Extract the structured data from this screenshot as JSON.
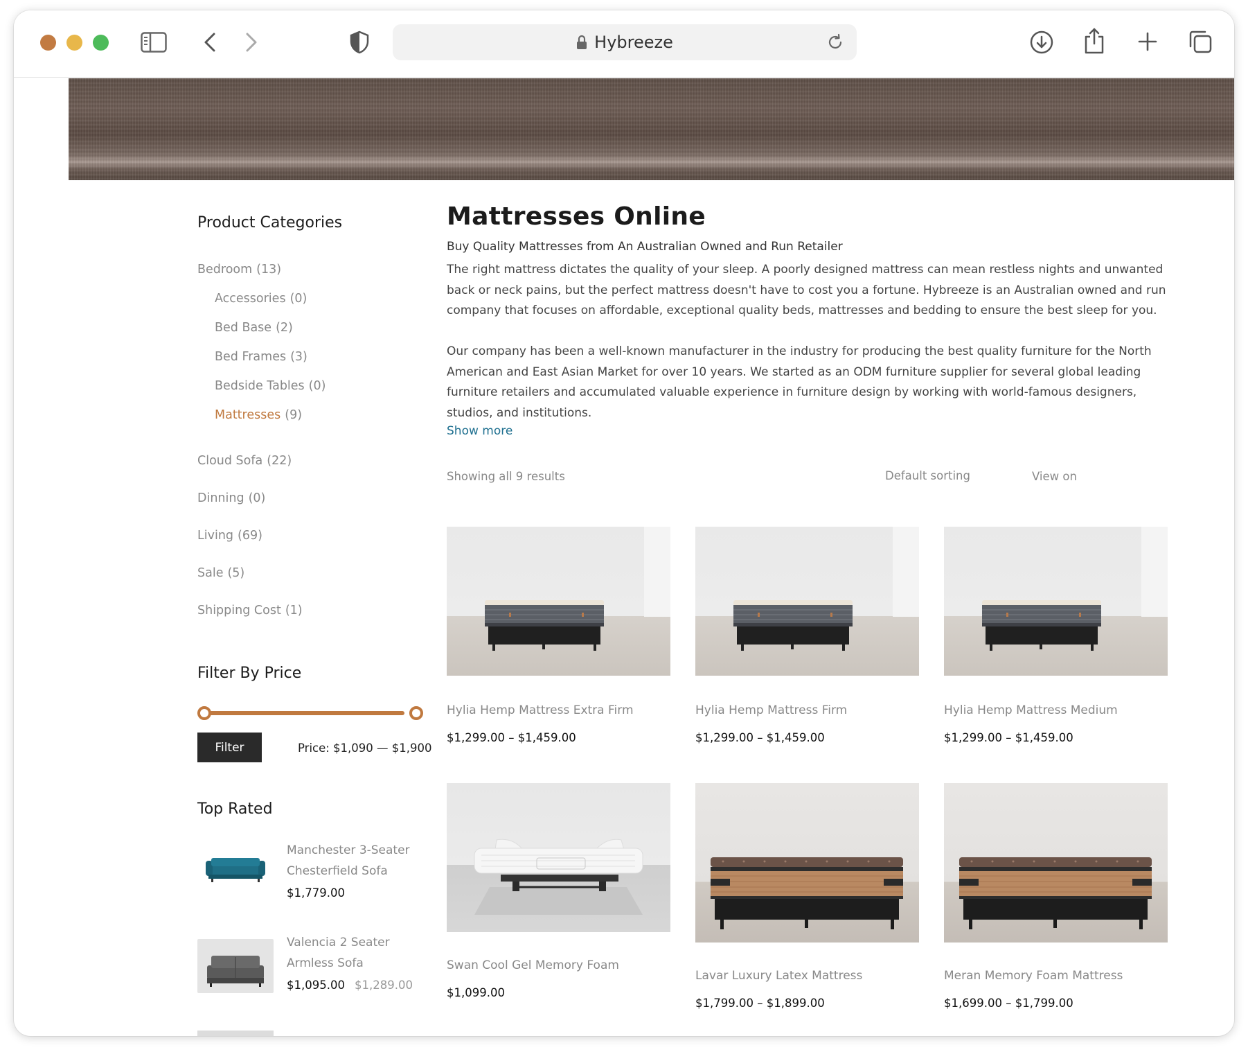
{
  "browser": {
    "url_text": "Hybreeze",
    "icons": [
      "sidebar-icon",
      "back-icon",
      "forward-icon",
      "shield-icon",
      "lock-icon",
      "reload-icon",
      "download-icon",
      "share-icon",
      "new-tab-icon",
      "tabs-overview-icon"
    ],
    "traffic_lights": [
      "#c27b42",
      "#e8b74a",
      "#4dbb5a"
    ]
  },
  "sidebar": {
    "categories_heading": "Product Categories",
    "categories": [
      {
        "label": "Bedroom",
        "count": "(13)"
      },
      {
        "label": "Accessories",
        "count": "(0)"
      },
      {
        "label": "Bed Base",
        "count": "(2)"
      },
      {
        "label": "Bed Frames",
        "count": "(3)"
      },
      {
        "label": "Bedside Tables",
        "count": "(0)"
      },
      {
        "label": "Mattresses",
        "count": "(9)"
      },
      {
        "label": "Cloud Sofa",
        "count": "(22)"
      },
      {
        "label": "Dinning",
        "count": "(0)"
      },
      {
        "label": "Living",
        "count": "(69)"
      },
      {
        "label": "Sale",
        "count": "(5)"
      },
      {
        "label": "Shipping Cost",
        "count": "(1)"
      }
    ],
    "filter_heading": "Filter By Price",
    "filter_button": "Filter",
    "price_range": "Price: $1,090 — $1,900",
    "top_rated_heading": "Top Rated",
    "top_rated": [
      {
        "name_line1": "Manchester 3-Seater",
        "name_line2": "Chesterfield Sofa",
        "price": "$1,779.00",
        "old_price": ""
      },
      {
        "name_line1": "Valencia 2 Seater",
        "name_line2": "Armless Sofa",
        "price": "$1,095.00",
        "old_price": "$1,289.00"
      }
    ]
  },
  "main": {
    "title": "Mattresses Online",
    "subtitle": "Buy Quality Mattresses from An Australian Owned and Run Retailer",
    "paragraph1": " The right mattress dictates the quality of your sleep. A poorly designed mattress can mean restless nights and unwanted back or neck pains, but the perfect mattress doesn't have to cost you a fortune. Hybreeze is an Australian owned and run company that focuses on affordable, exceptional quality beds, mattresses and bedding to ensure the best sleep for you.",
    "paragraph2": " Our company has been a well-known manufacturer in the industry for producing the best quality furniture for the North American and East Asian Market for over 10 years. We started as an ODM furniture supplier for several global leading furniture retailers and accumulated valuable experience in furniture design by working with world-famous designers, studios, and institutions.",
    "show_more": "Show more",
    "result_count": "Showing all 9 results",
    "sorting": "Default sorting",
    "view_on": "View on"
  },
  "products": [
    {
      "name": "Hylia Hemp Mattress Extra Firm",
      "price": "$1,299.00 – $1,459.00"
    },
    {
      "name": "Hylia Hemp Mattress Firm",
      "price": "$1,299.00 – $1,459.00"
    },
    {
      "name": "Hylia Hemp Mattress Medium",
      "price": "$1,299.00 – $1,459.00"
    },
    {
      "name": "Swan Cool Gel Memory Foam",
      "price": "$1,099.00"
    },
    {
      "name": "Lavar Luxury Latex Mattress",
      "price": "$1,799.00 – $1,899.00"
    },
    {
      "name": "Meran Memory Foam Mattress",
      "price": "$1,699.00 – $1,799.00"
    }
  ],
  "colors": {
    "accent": "#c0793f",
    "link": "#1e6f8f",
    "button_dark": "#2a2a2a"
  }
}
